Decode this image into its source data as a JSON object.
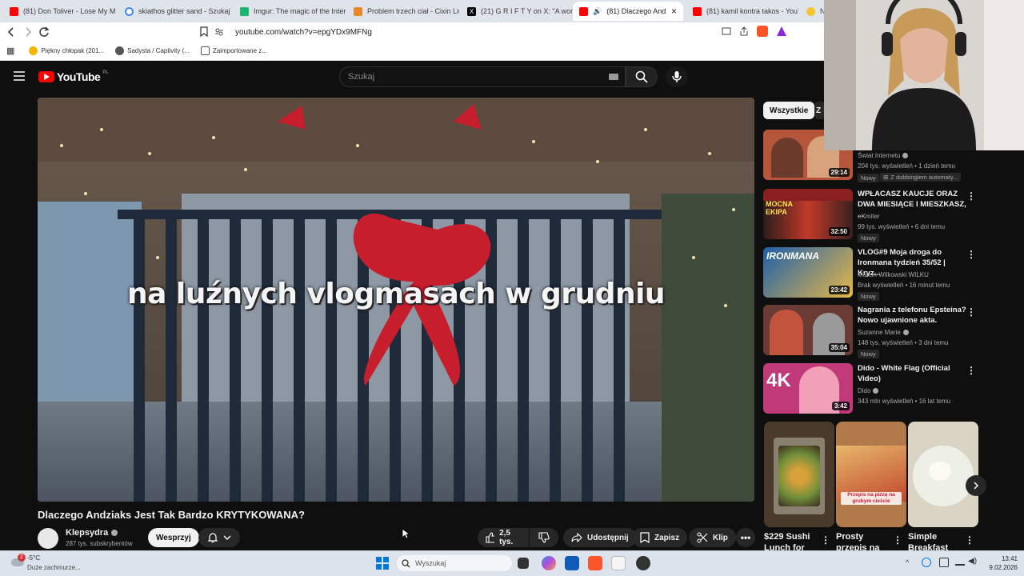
{
  "browser": {
    "tabs": [
      {
        "label": "(81) Don Toliver - Lose My Mi",
        "icon": "youtube-icon"
      },
      {
        "label": "skiathos glitter sand - Szukaj w",
        "icon": "google-icon"
      },
      {
        "label": "Imgur: The magic of the Intern",
        "icon": "imgur-icon"
      },
      {
        "label": "Problem trzech ciał - Cixin Liu",
        "icon": "book-icon"
      },
      {
        "label": "(21) G R I F T Y on X: \"A woma",
        "icon": "x-icon"
      },
      {
        "label": "(81) Dlaczego Andziak",
        "icon": "youtube-icon"
      },
      {
        "label": "(81) kamil kontra takos - YouTu",
        "icon": "youtube-icon"
      },
      {
        "label": "N",
        "icon": "generic-icon"
      }
    ],
    "active_tab_close": "×",
    "url": "youtube.com/watch?v=epgYDx9MFNg",
    "bookmarks": [
      {
        "label": "Piękny chłopak (201...",
        "icon": "smile-icon"
      },
      {
        "label": "Sadysta / Captivity (...",
        "icon": "globe-icon"
      },
      {
        "label": "Zaimportowane z...",
        "icon": "folder-icon"
      }
    ]
  },
  "youtube": {
    "logo_text": "YouTube",
    "region": "PL",
    "search_placeholder": "Szukaj",
    "video": {
      "caption": "na luźnych vlogmasach w grudniu",
      "title": "Dlaczego Andziaks Jest Tak Bardzo KRYTYKOWANA?",
      "channel": "Klepsydra",
      "subscribers": "287 tys. subskrybentów",
      "support_label": "Wesprzyj",
      "likes": "2,5 tys.",
      "share_label": "Udostępnij",
      "save_label": "Zapisz",
      "clip_label": "Klip"
    },
    "chips": [
      {
        "label": "Wszystkie",
        "active": true
      },
      {
        "label": "Z",
        "active": false
      }
    ],
    "recommendations": [
      {
        "title": "",
        "channel": "Świat Internetu",
        "verified": true,
        "stats": "204 tys. wyświetleń • 1 dzień temu",
        "badge": "Nowy",
        "extra": "Z dubbingiem automaty...",
        "duration": "29:14",
        "thumb_color": "#b5563a"
      },
      {
        "title": "WPŁACASZ KAUCJE ORAZ DWA MIESIĄCE I MIESZKASZ, ...",
        "channel": "eXmiter",
        "verified": false,
        "stats": "99 tys. wyświetleń • 6 dni temu",
        "badge": "Nowy",
        "duration": "32:50",
        "thumb_color": "#8a1f1f",
        "thumb_text": "MOCNA EKIPA"
      },
      {
        "title": "VLOG#9 Moja droga do Ironmana tydzień 35/52 | Kryz...",
        "channel": "Marcin Wilkowski WILKU",
        "verified": false,
        "stats": "Brak wyświetleń • 16 minut temu",
        "badge": "Nowy",
        "duration": "23:42",
        "thumb_color": "#1d5fa8",
        "thumb_text": "IRONMANA"
      },
      {
        "title": "Nagrania z telefonu Epsteina? Nowo ujawnione akta.",
        "channel": "Suzanne Marie",
        "verified": true,
        "stats": "148 tys. wyświetleń • 3 dni temu",
        "badge": "Nowy",
        "duration": "35:04",
        "thumb_color": "#6a3b34"
      },
      {
        "title": "Dido - White Flag (Official Video)",
        "channel": "Dido",
        "verified": true,
        "stats": "343 mln wyświetleń • 16 lat temu",
        "badge": "",
        "duration": "3:42",
        "thumb_color": "#c03a7a",
        "thumb_text": "4K"
      }
    ],
    "shorts": [
      {
        "title": "$229 Sushi Lunch for",
        "thumb_color": "#4a3a2c"
      },
      {
        "title": "Prosty przepis na",
        "thumb_color": "#b07a4a",
        "thumb_text": "Przepis na pizzę na grubym cieście"
      },
      {
        "title": "Simple Breakfast",
        "thumb_color": "#d9d4c4"
      }
    ]
  },
  "taskbar": {
    "weather_temp": "-5°C",
    "weather_desc": "Duże zachmurze...",
    "weather_badge": "2",
    "search_placeholder": "Wyszukaj",
    "time": "13:41",
    "date": "9.02.2026"
  }
}
